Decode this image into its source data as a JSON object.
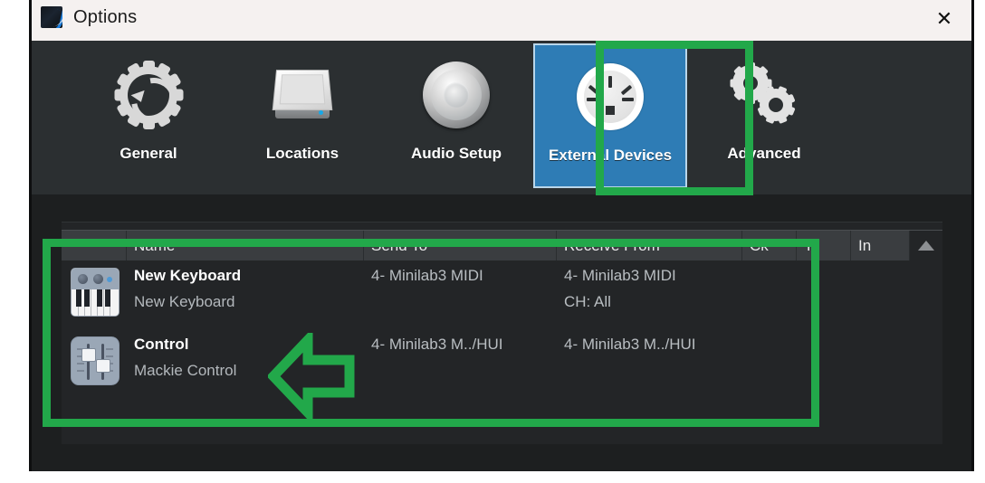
{
  "window": {
    "title": "Options",
    "app_icon": "app-logo-icon",
    "close_label": "✕"
  },
  "toolbar": {
    "items": [
      {
        "label": "General",
        "icon": "gear-refresh-icon",
        "selected": false
      },
      {
        "label": "Locations",
        "icon": "hard-drive-icon",
        "selected": false
      },
      {
        "label": "Audio Setup",
        "icon": "audio-knob-icon",
        "selected": false
      },
      {
        "label": "External Devices",
        "icon": "midi-din-icon",
        "selected": true
      },
      {
        "label": "Advanced",
        "icon": "double-gear-icon",
        "selected": false
      }
    ],
    "selected_index": 3
  },
  "table": {
    "columns": [
      {
        "key": "icon",
        "label": ""
      },
      {
        "key": "name",
        "label": "Name"
      },
      {
        "key": "send",
        "label": "Send To"
      },
      {
        "key": "receive",
        "label": "Receive From"
      },
      {
        "key": "ck",
        "label": "Ck"
      },
      {
        "key": "tc",
        "label": "Tc"
      },
      {
        "key": "in",
        "label": "In"
      }
    ],
    "scroll_up_icon": "scroll-up-arrow-icon",
    "rows": [
      {
        "icon": "midi-keyboard-icon",
        "name_primary": "New Keyboard",
        "name_secondary": "New Keyboard",
        "send_to": "4- Minilab3 MIDI",
        "receive_from": "4- Minilab3 MIDI",
        "receive_from_line2": "CH: All",
        "ck": "",
        "tc": "",
        "in": ""
      },
      {
        "icon": "mixer-faders-icon",
        "name_primary": "Control",
        "name_secondary": "Mackie Control",
        "send_to": "4- Minilab3 M../HUI",
        "receive_from": "4- Minilab3 M../HUI",
        "receive_from_line2": "",
        "ck": "",
        "tc": "",
        "in": ""
      }
    ]
  },
  "annotations": {
    "color": "#22a84a",
    "toolbar_highlight": "external-devices-highlight",
    "table_highlight": "device-list-highlight",
    "arrow": "left-pointing-arrow"
  }
}
